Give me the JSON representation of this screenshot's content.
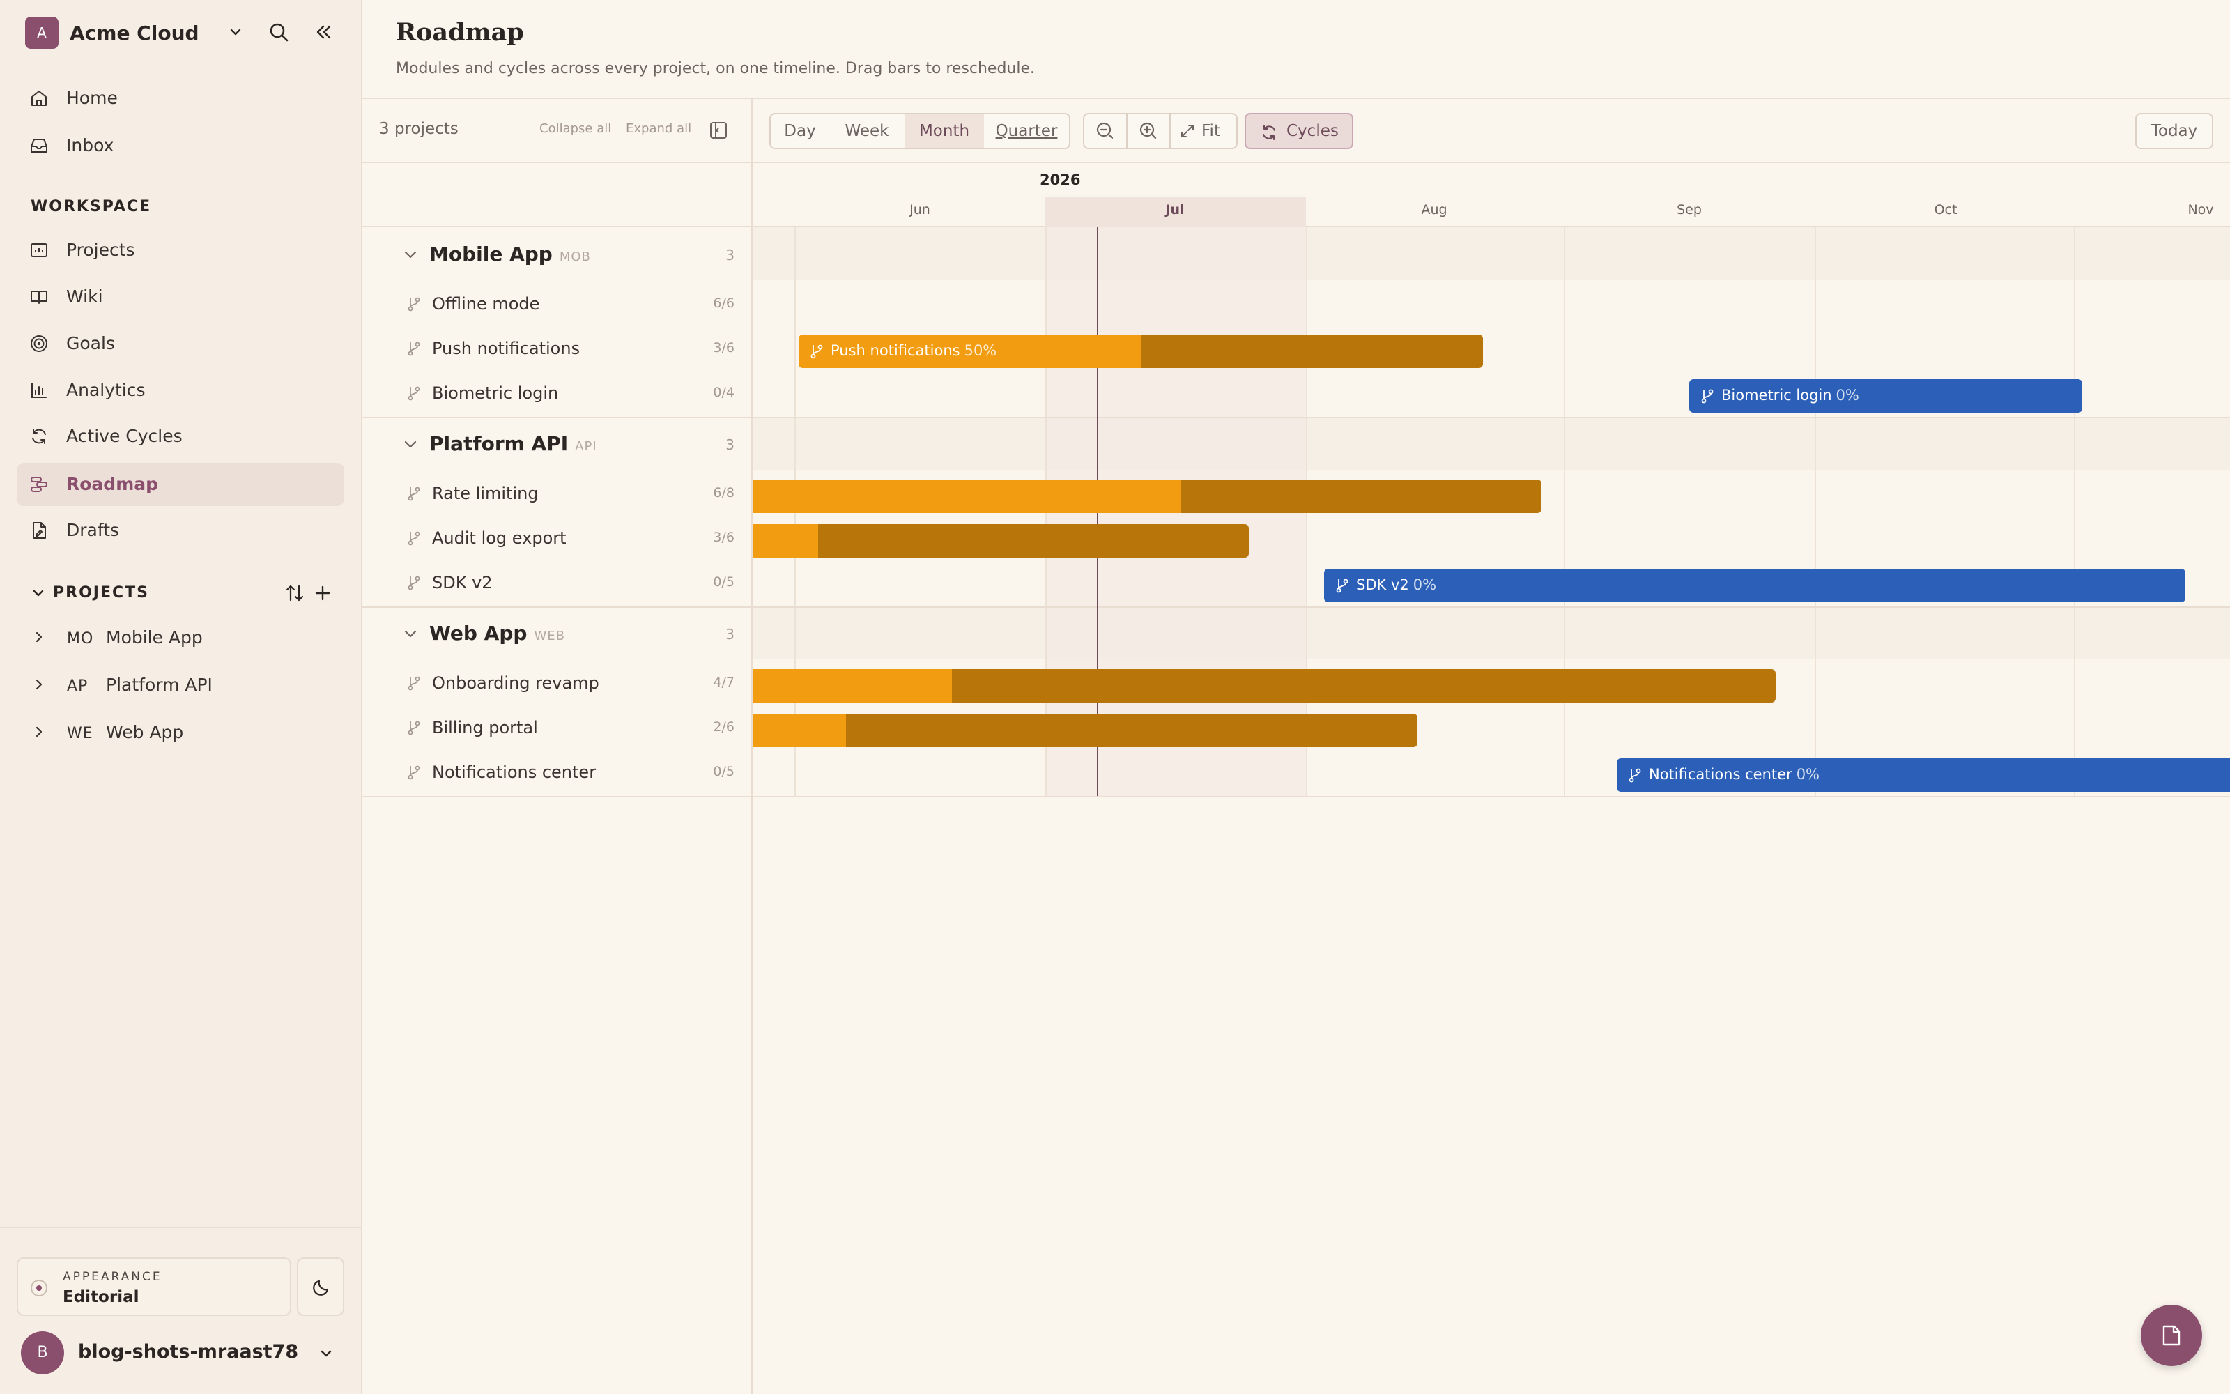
{
  "workspace": {
    "initial": "A",
    "name": "Acme Cloud"
  },
  "nav": {
    "home": "Home",
    "inbox": "Inbox",
    "workspace_title": "WORKSPACE",
    "projects": "Projects",
    "wiki": "Wiki",
    "goals": "Goals",
    "analytics": "Analytics",
    "active_cycles": "Active Cycles",
    "roadmap": "Roadmap",
    "drafts": "Drafts",
    "projects_title": "PROJECTS"
  },
  "sidebar_projects": [
    {
      "code": "MO",
      "name": "Mobile App"
    },
    {
      "code": "AP",
      "name": "Platform API"
    },
    {
      "code": "WE",
      "name": "Web App"
    }
  ],
  "appearance": {
    "caption": "APPEARANCE",
    "value": "Editorial"
  },
  "user": {
    "initial": "B",
    "name": "blog-shots-mraast78"
  },
  "page": {
    "title": "Roadmap",
    "subtitle": "Modules and cycles across every project, on one timeline. Drag bars to reschedule."
  },
  "list": {
    "count": "3 projects",
    "collapse_all": "Collapse all",
    "expand_all": "Expand all"
  },
  "toolbar": {
    "scales": [
      "Day",
      "Week",
      "Month",
      "Quarter"
    ],
    "active_scale": "Month",
    "fit": "Fit",
    "cycles": "Cycles",
    "today": "Today"
  },
  "timeline": {
    "year": "2026",
    "months": [
      "Jun",
      "Jul",
      "Aug",
      "Sep",
      "Oct",
      "Nov"
    ],
    "current_month": "Jul"
  },
  "groups": [
    {
      "name": "Mobile App",
      "code": "MOB",
      "count": "3",
      "modules": [
        {
          "name": "Offline mode",
          "count": "6/6"
        },
        {
          "name": "Push notifications",
          "count": "3/6",
          "bar_label": "Push notifications",
          "bar_pct": "50%",
          "progress": 0.5
        },
        {
          "name": "Biometric login",
          "count": "0/4",
          "bar_label": "Biometric login",
          "bar_pct": "0%",
          "progress": 0
        }
      ]
    },
    {
      "name": "Platform API",
      "code": "API",
      "count": "3",
      "modules": [
        {
          "name": "Rate limiting",
          "count": "6/8"
        },
        {
          "name": "Audit log export",
          "count": "3/6"
        },
        {
          "name": "SDK v2",
          "count": "0/5",
          "bar_label": "SDK v2",
          "bar_pct": "0%",
          "progress": 0
        }
      ]
    },
    {
      "name": "Web App",
      "code": "WEB",
      "count": "3",
      "modules": [
        {
          "name": "Onboarding revamp",
          "count": "4/7"
        },
        {
          "name": "Billing portal",
          "count": "2/6"
        },
        {
          "name": "Notifications center",
          "count": "0/5",
          "bar_label": "Notifications center",
          "bar_pct": "0%",
          "progress": 0
        }
      ]
    }
  ],
  "colors": {
    "accent": "#8b4f6e",
    "progress_done": "#f29c12",
    "progress_rest": "#b8750a",
    "planned": "#2b5fb8"
  }
}
